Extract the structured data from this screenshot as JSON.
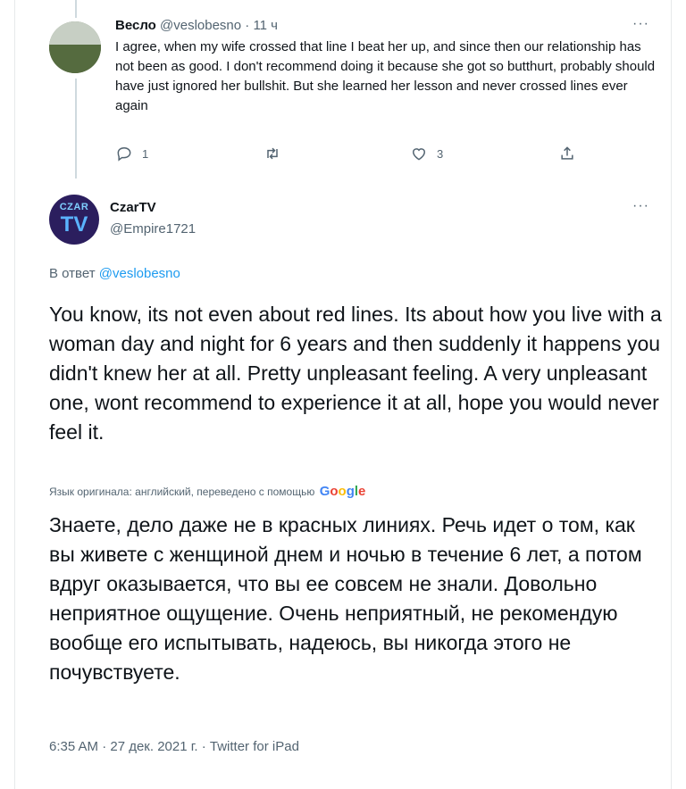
{
  "parent_tweet": {
    "display_name": "Весло",
    "meta": "@veslobesno · 11 ч",
    "text": "I agree, when my wife crossed that line I beat her up, and since then our relationship has not been as good. I don't recommend doing it because she got so butthurt, probably should have just ignored her bullshit. But she learned her lesson and never crossed lines ever again",
    "more": "···",
    "reply_count": "1",
    "retweet_count": "",
    "like_count": "3"
  },
  "main_tweet": {
    "display_name": "CzarTV",
    "handle": "@Empire1721",
    "more": "···",
    "avatar_text_top": "CZAR",
    "avatar_text_bottom": "TV",
    "replying_prefix": "В ответ",
    "replying_mention": "@veslobesno",
    "text": "You know, its not even about red lines. Its about how you live with a woman day and night for 6 years and then suddenly it happens you didn't knew her at all. Pretty unpleasant feeling. A very unpleasant one, wont recommend to experience it at all, hope you would never feel it.",
    "translation_note": "Язык оригинала: английский, переведено с помощью",
    "translation_provider": [
      "G",
      "o",
      "o",
      "g",
      "l",
      "e"
    ],
    "translated_text": "Знаете, дело даже не в красных линиях. Речь идет о том, как вы живете с женщиной днем и ночью в течение 6 лет, а потом вдруг оказывается, что вы ее совсем не знали. Довольно неприятное ощущение. Очень неприятный, не рекомендую вообще его испытывать, надеюсь, вы никогда этого не почувствуете.",
    "timestamp": "6:35 AM · 27 дек. 2021 г. · Twitter for iPad"
  },
  "icons": {
    "reply": "reply-icon",
    "retweet": "retweet-icon",
    "like": "like-icon",
    "share": "share-icon"
  },
  "colors": {
    "link": "#1d9bf0",
    "secondary_text": "#536471",
    "primary_text": "#0f1419"
  }
}
